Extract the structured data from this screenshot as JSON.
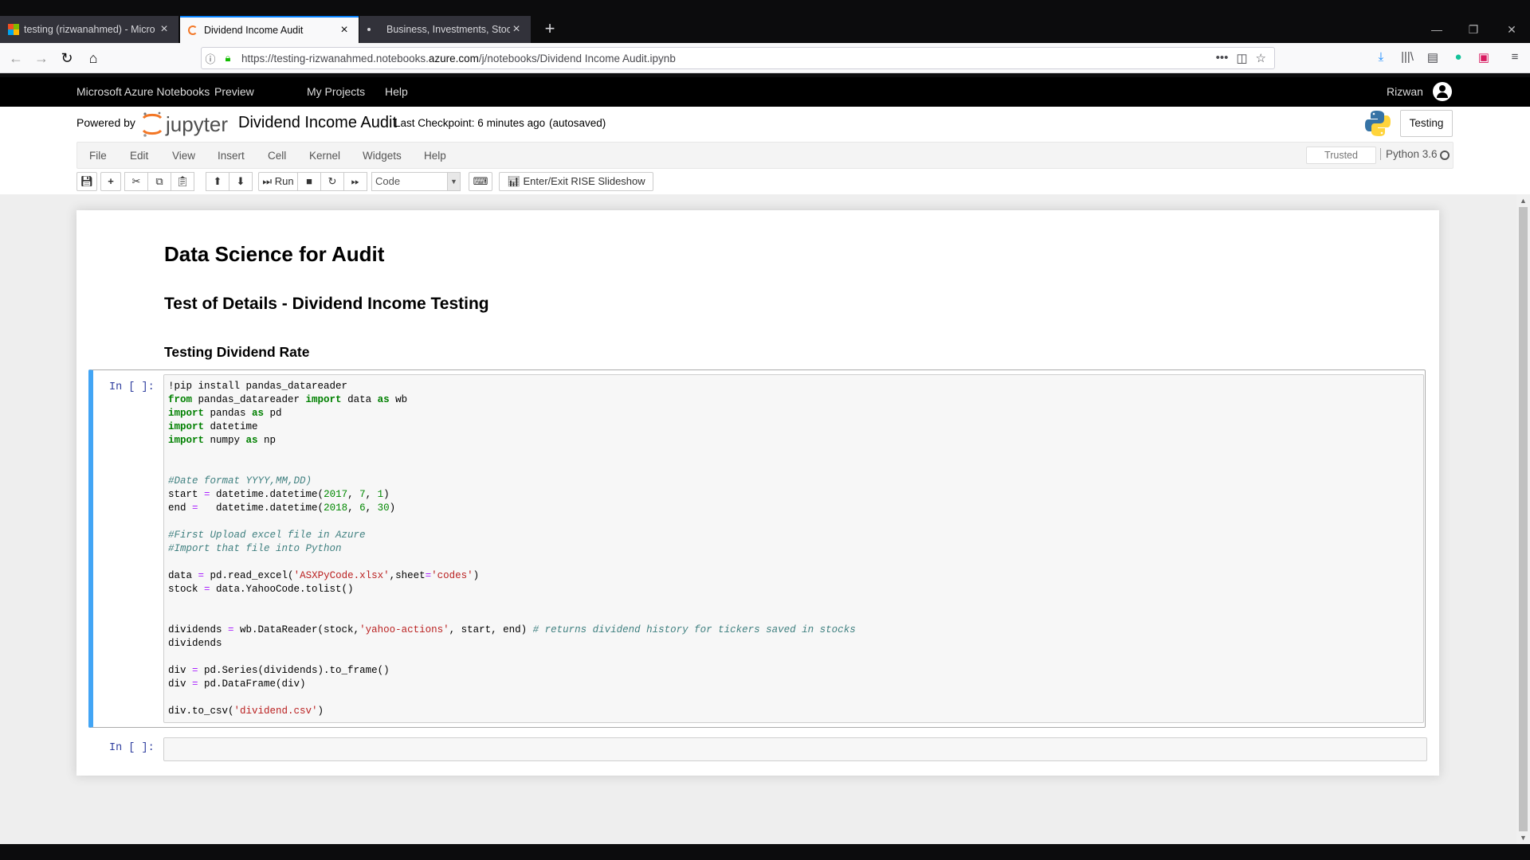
{
  "browser": {
    "tabs": [
      {
        "title": "testing (rizwanahmed) - Micro"
      },
      {
        "title": "Dividend Income Audit"
      },
      {
        "title": "Business, Investments, Stocks &"
      }
    ],
    "new_tab": "+",
    "url_prefix": "https://testing-rizwanahmed.notebooks.",
    "url_domain": "azure.com",
    "url_path": "/j/notebooks/Dividend Income Audit.ipynb"
  },
  "azure": {
    "brand": "Microsoft Azure Notebooks",
    "preview": "Preview",
    "my_projects": "My Projects",
    "help": "Help",
    "user": "Rizwan"
  },
  "jupyter": {
    "powered_by": "Powered by",
    "notebook_title": "Dividend Income Audit",
    "checkpoint": "Last Checkpoint: 6 minutes ago",
    "autosaved": "(autosaved)",
    "kernel_button": "Testing",
    "menu": [
      "File",
      "Edit",
      "View",
      "Insert",
      "Cell",
      "Kernel",
      "Widgets",
      "Help"
    ],
    "trusted": "Trusted",
    "kernel_name": "Python 3.6",
    "toolbar": {
      "run": "Run",
      "cell_type": "Code",
      "rise": "Enter/Exit RISE Slideshow"
    }
  },
  "notebook": {
    "h1": "Data Science for Audit",
    "h2": "Test of Details - Dividend Income Testing",
    "h3": "Testing Dividend Rate",
    "prompt1": "In [ ]:",
    "prompt2": "In [ ]:",
    "code_lines": [
      "!pip install pandas_datareader",
      "from pandas_datareader import data as wb",
      "import pandas as pd",
      "import datetime",
      "import numpy as np",
      "",
      "",
      "#Date format YYYY,MM,DD)",
      "start = datetime.datetime(2017, 7, 1)",
      "end =   datetime.datetime(2018, 6, 30)",
      "",
      "#First Upload excel file in Azure",
      "#Import that file into Python",
      "",
      "data = pd.read_excel('ASXPyCode.xlsx',sheet='codes')",
      "stock = data.YahooCode.tolist()",
      "",
      "",
      "dividends = wb.DataReader(stock,'yahoo-actions', start, end) # returns dividend history for tickers saved in stocks",
      "dividends",
      "",
      "div = pd.Series(dividends).to_frame()",
      "div = pd.DataFrame(div)",
      "",
      "div.to_csv('dividend.csv')"
    ]
  }
}
